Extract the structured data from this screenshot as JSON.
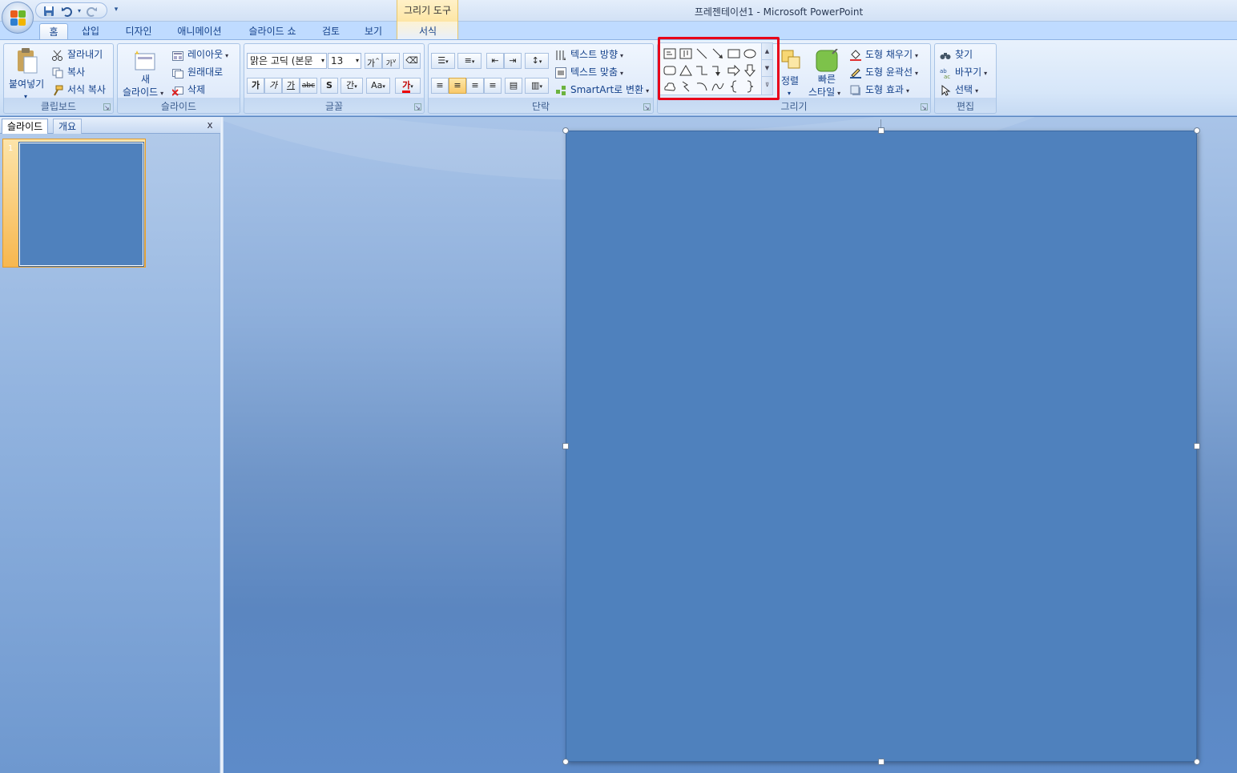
{
  "window": {
    "title": "프레젠테이션1 - Microsoft PowerPoint",
    "context_tab_group": "그리기 도구"
  },
  "tabs": [
    {
      "label": "홈",
      "active": true
    },
    {
      "label": "삽입",
      "active": false
    },
    {
      "label": "디자인",
      "active": false
    },
    {
      "label": "애니메이션",
      "active": false
    },
    {
      "label": "슬라이드 쇼",
      "active": false
    },
    {
      "label": "검토",
      "active": false
    },
    {
      "label": "보기",
      "active": false
    },
    {
      "label": "서식",
      "active": false
    }
  ],
  "clipboard": {
    "label": "클립보드",
    "paste": "붙여넣기",
    "cut": "잘라내기",
    "copy": "복사",
    "format_painter": "서식 복사"
  },
  "slides_group": {
    "label": "슬라이드",
    "new_slide_1": "새",
    "new_slide_2": "슬라이드",
    "layout": "레이아웃",
    "reset": "원래대로",
    "delete": "삭제"
  },
  "font": {
    "label": "글꼴",
    "font_name": "맑은 고딕 (본문",
    "font_size": "13",
    "grow": "가",
    "shrink": "가",
    "bold": "가",
    "italic": "가",
    "underline": "가",
    "strike": "abc",
    "shadow": "S",
    "spacing": "간",
    "case": "Aa",
    "color": "가"
  },
  "paragraph": {
    "label": "단락",
    "text_direction": "텍스트 방향",
    "align_text": "텍스트 맞춤",
    "smartart": "SmartArt로 변환"
  },
  "drawing": {
    "label": "그리기",
    "arrange": "정렬",
    "quick_styles_1": "빠른",
    "quick_styles_2": "스타일",
    "shape_fill": "도형 채우기",
    "shape_outline": "도형 윤곽선",
    "shape_effects": "도형 효과"
  },
  "editing": {
    "label": "편집",
    "find": "찾기",
    "replace": "바꾸기",
    "select": "선택"
  },
  "left_panel": {
    "tab_slides": "슬라이드",
    "tab_outline": "개요",
    "close": "x",
    "thumb_number": "1"
  },
  "colors": {
    "slide_fill": "#4f81bd",
    "highlight": "#e8001a",
    "selected_thumb": "#f7b74f"
  }
}
